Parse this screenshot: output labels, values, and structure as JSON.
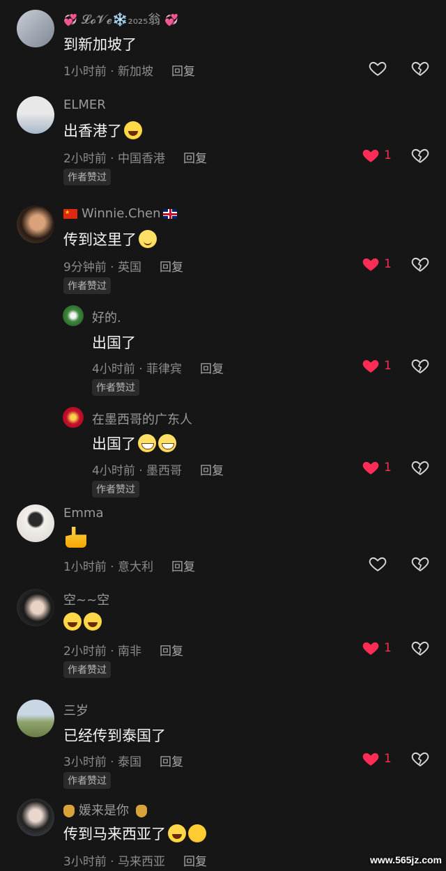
{
  "comments": [
    {
      "username": "𝓛𝓸𝓥𝓮❄️₂₀₂₅翁",
      "text": "到新加坡了",
      "time": "1小时前 · 新加坡",
      "reply": "回复",
      "likes": "",
      "liked": false,
      "badge": ""
    },
    {
      "username": "ELMER",
      "text": "出香港了",
      "time": "2小时前 · 中国香港",
      "reply": "回复",
      "likes": "1",
      "liked": true,
      "badge": "作者赞过"
    },
    {
      "username": "Winnie.Chen",
      "text": "传到这里了",
      "time": "9分钟前 · 英国",
      "reply": "回复",
      "likes": "1",
      "liked": true,
      "badge": "作者赞过"
    },
    {
      "username": "好的.",
      "text": "出国了",
      "time": "4小时前 · 菲律宾",
      "reply": "回复",
      "likes": "1",
      "liked": true,
      "badge": "作者赞过"
    },
    {
      "username": "在墨西哥的广东人",
      "text": "出国了",
      "time": "4小时前 · 墨西哥",
      "reply": "回复",
      "likes": "1",
      "liked": true,
      "badge": "作者赞过"
    },
    {
      "username": "Emma",
      "text": "",
      "time": "1小时前 · 意大利",
      "reply": "回复",
      "likes": "",
      "liked": false,
      "badge": ""
    },
    {
      "username": "空~~空",
      "text": "",
      "time": "2小时前 · 南非",
      "reply": "回复",
      "likes": "1",
      "liked": true,
      "badge": "作者赞过"
    },
    {
      "username": "三岁",
      "text": "已经传到泰国了",
      "time": "3小时前 · 泰国",
      "reply": "回复",
      "likes": "1",
      "liked": true,
      "badge": "作者赞过"
    },
    {
      "username": "媛来是你",
      "text": "传到马来西亚了",
      "time": "3小时前 · 马来西亚",
      "reply": "回复",
      "likes": "",
      "liked": false,
      "badge": ""
    }
  ],
  "watermark": "www.565jz.com",
  "colors": {
    "accent": "#ff2c55",
    "background": "#161616"
  }
}
